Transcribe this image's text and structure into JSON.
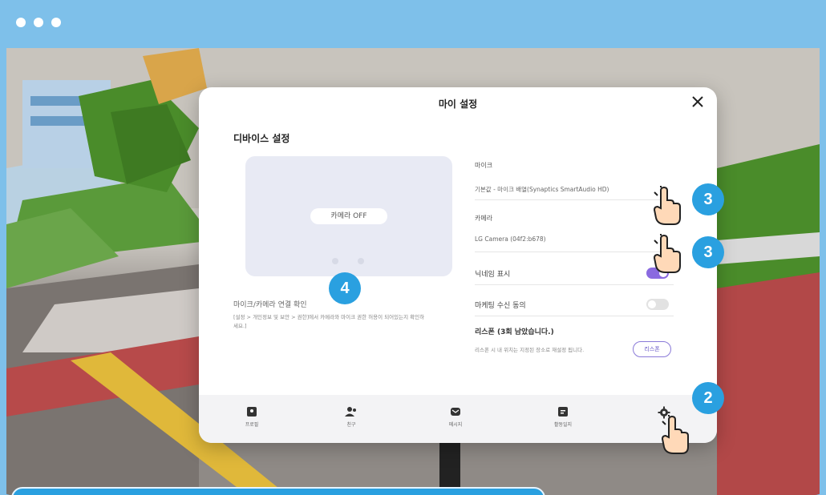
{
  "modal": {
    "title": "마이 설정",
    "section_title": "디바이스 설정",
    "camera_off_label": "카메라 OFF",
    "connection_title": "마이크/카메라 연결 확인",
    "connection_desc": "[설정 > 개인정보 및 보안 > 권한]에서 카메라와 마이크 권한 허용이 되어있는지 확인하세요.]",
    "mic": {
      "label": "마이크",
      "value": "기본값 - 마이크 배열(Synaptics SmartAudio HD)"
    },
    "camera": {
      "label": "카메라",
      "value": "LG Camera (04f2:b678)"
    },
    "nickname_toggle": {
      "label": "닉네임 표시",
      "on": true
    },
    "marketing_toggle": {
      "label": "마케팅 수신 동의",
      "on": false
    },
    "respawn": {
      "title": "리스폰 (3회 남았습니다.)",
      "desc": "리스폰 시 내 위치는 지정된 장소로 재설정 됩니다.",
      "button_label": "리스폰"
    }
  },
  "bottom_nav": [
    {
      "label": "프로필",
      "icon": "profile-icon"
    },
    {
      "label": "친구",
      "icon": "friends-icon"
    },
    {
      "label": "메시지",
      "icon": "message-icon"
    },
    {
      "label": "활동일지",
      "icon": "activity-log-icon"
    },
    {
      "label": "",
      "icon": "gear-icon"
    }
  ],
  "badges": {
    "mic": "3",
    "camera": "3",
    "connection": "4",
    "settings": "2"
  },
  "colors": {
    "accent": "#8a6ae0",
    "badge": "#2aa0e0",
    "frame": "#7ec0ea"
  }
}
